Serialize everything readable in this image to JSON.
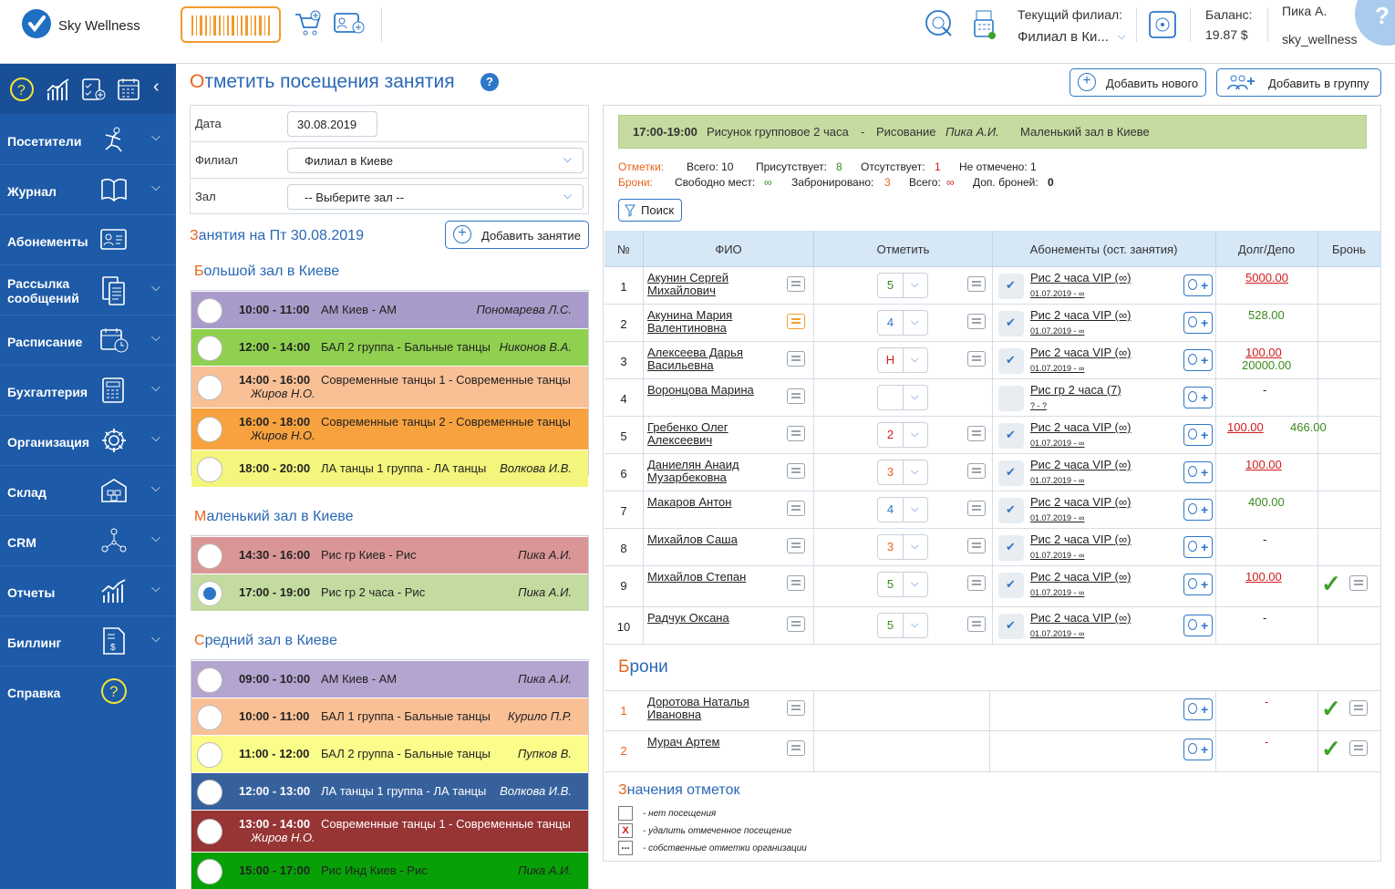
{
  "app": {
    "name": "Sky Wellness"
  },
  "header": {
    "branch_label": "Текущий филиал:",
    "branch_value": "Филиал в Ки...",
    "balance_label": "Баланс:",
    "balance_value": "19.87 $",
    "user_name": "Пика А.",
    "user_login": "sky_wellness",
    "help": "?"
  },
  "sidebar": {
    "items": [
      {
        "label": "Посетители"
      },
      {
        "label": "Журнал"
      },
      {
        "label": "Абонементы"
      },
      {
        "label": "Рассылка сообщений"
      },
      {
        "label": "Расписание"
      },
      {
        "label": "Бухгалтерия"
      },
      {
        "label": "Организация"
      },
      {
        "label": "Склад"
      },
      {
        "label": "CRM"
      },
      {
        "label": "Отчеты"
      },
      {
        "label": "Биллинг"
      },
      {
        "label": "Справка"
      }
    ]
  },
  "page": {
    "title": "Отметить посещения занятия",
    "add_new": "Добавить нового",
    "add_to_group": "Добавить в группу",
    "help": "?"
  },
  "filters": {
    "date_label": "Дата",
    "date_value": "30.08.2019",
    "branch_label": "Филиал",
    "branch_value": "Филиал в Киеве",
    "hall_label": "Зал",
    "hall_value": "-- Выберите зал --"
  },
  "schedule": {
    "title": "Занятия на Пт 30.08.2019",
    "add_lesson": "Добавить занятие",
    "halls": [
      {
        "name": "Большой зал в Киеве",
        "classes": [
          {
            "time": "10:00 - 11:00",
            "name": "АМ Киев - АМ",
            "teacher": "Пономарева Л.С.",
            "color": "#a99bc9"
          },
          {
            "time": "12:00 - 14:00",
            "name": "БАЛ 2 группа - Бальные танцы",
            "teacher": "Никонов В.А.",
            "color": "#8fd14f"
          },
          {
            "time": "14:00 - 16:00",
            "name": "Современные танцы 1 - Современные танцы",
            "teacher": "Жиров Н.О.",
            "color": "#f9c096"
          },
          {
            "time": "16:00 - 18:00",
            "name": "Современные танцы 2 - Современные танцы",
            "teacher": "Жиров Н.О.",
            "color": "#f8a23f"
          },
          {
            "time": "18:00 - 20:00",
            "name": "ЛА танцы 1 группа - ЛА танцы",
            "teacher": "Волкова И.В.",
            "color": "#f4f57c"
          }
        ]
      },
      {
        "name": "Маленький зал в Киеве",
        "classes": [
          {
            "time": "14:30 - 16:00",
            "name": "Рис гр Киев - Рис",
            "teacher": "Пика А.И.",
            "color": "#da9696"
          },
          {
            "time": "17:00 - 19:00",
            "name": "Рис гр 2 часа - Рис",
            "teacher": "Пика А.И.",
            "color": "#c4dba0"
          }
        ]
      },
      {
        "name": "Средний зал в Киеве",
        "classes": [
          {
            "time": "09:00 - 10:00",
            "name": "АМ Киев - АМ",
            "teacher": "Пика А.И.",
            "color": "#b3a4d0"
          },
          {
            "time": "10:00 - 11:00",
            "name": "БАЛ 1 группа - Бальные танцы",
            "teacher": "Курило П.Р.",
            "color": "#f9c096"
          },
          {
            "time": "11:00 - 12:00",
            "name": "БАЛ 2 группа - Бальные танцы",
            "teacher": "Пупков В.",
            "color": "#fbfd8a"
          },
          {
            "time": "12:00 - 13:00",
            "name": "ЛА танцы 1 группа - ЛА танцы",
            "teacher": "Волкова И.В.",
            "color": "#36619d"
          },
          {
            "time": "13:00 - 14:00",
            "name": "Современные танцы 1 - Современные танцы",
            "teacher": "Жиров Н.О.",
            "color": "#973434"
          },
          {
            "time": "15:00 - 17:00",
            "name": "Рис Инд Киев - Рис",
            "teacher": "Пика А.И.",
            "color": "#07a007"
          }
        ]
      }
    ]
  },
  "lesson": {
    "time": "17:00-19:00",
    "name": "Рисунок групповое 2 часа",
    "dash": "-",
    "subject": "Рисование",
    "teacher": "Пика А.И.",
    "hall": "Маленький зал в Киеве"
  },
  "stats": {
    "marks_label": "Отметки:",
    "total": "Всего: 10",
    "present_label": "Присутствует:",
    "present": "8",
    "absent_label": "Отсутствует:",
    "absent": "1",
    "unmarked": "Не отмечено: 1",
    "booking_label": "Брони:",
    "free_label": "Свободно мест:",
    "free": "∞",
    "booked_label": "Забронировано:",
    "booked": "3",
    "total2_label": "Всего:",
    "total2": "∞",
    "extra_label": "Доп. броней:",
    "extra": "0"
  },
  "search_btn": "Поиск",
  "table": {
    "headers": [
      "№",
      "ФИО",
      "Отметить",
      "Абонементы (ост. занятия)",
      "Долг/Депо",
      "Бронь"
    ],
    "rows": [
      {
        "n": "1",
        "name1": "Акунин Сергей",
        "name2": "Михайлович",
        "mark": "5",
        "sub": "Рис 2 часа VIP (∞)",
        "subdate": "01.07.2019 - ∞",
        "debt_red": "5000.00",
        "debt_green": ""
      },
      {
        "n": "2",
        "name1": "Акунина Мария",
        "name2": "Валентиновна",
        "mark": "4",
        "sub": "Рис 2 часа VIP (∞)",
        "subdate": "01.07.2019 - ∞",
        "debt_red": "",
        "debt_green": "528.00"
      },
      {
        "n": "3",
        "name1": "Алексеева Дарья",
        "name2": "Васильевна",
        "mark": "Н",
        "sub": "Рис 2 часа VIP (∞)",
        "subdate": "01.07.2019 - ∞",
        "debt_red": "100.00",
        "debt_green": "20000.00"
      },
      {
        "n": "4",
        "name1": "Воронцова Марина",
        "name2": "",
        "mark": "",
        "sub": "Рис гр 2 часа (7)",
        "subdate": "? - ?",
        "debt_red": "",
        "debt_green": "-"
      },
      {
        "n": "5",
        "name1": "Гребенко Олег",
        "name2": "Алексеевич",
        "mark": "2",
        "sub": "Рис 2 часа VIP (∞)",
        "subdate": "01.07.2019 - ∞",
        "debt_red": "100.00",
        "debt_green": "466.00"
      },
      {
        "n": "6",
        "name1": "Даниелян Анаид",
        "name2": "Музарбековна",
        "mark": "3",
        "sub": "Рис 2 часа VIP (∞)",
        "subdate": "01.07.2019 - ∞",
        "debt_red": "100.00",
        "debt_green": ""
      },
      {
        "n": "7",
        "name1": "Макаров Антон",
        "name2": "",
        "mark": "4",
        "sub": "Рис 2 часа VIP (∞)",
        "subdate": "01.07.2019 - ∞",
        "debt_red": "",
        "debt_green": "400.00"
      },
      {
        "n": "8",
        "name1": "Михайлов Саша",
        "name2": "",
        "mark": "3",
        "sub": "Рис 2 часа VIP (∞)",
        "subdate": "01.07.2019 - ∞",
        "debt_red": "",
        "debt_green": "-"
      },
      {
        "n": "9",
        "name1": "Михайлов Степан",
        "name2": "",
        "mark": "5",
        "sub": "Рис 2 часа VIP (∞)",
        "subdate": "01.07.2019 - ∞",
        "debt_red": "100.00",
        "debt_green": ""
      },
      {
        "n": "10",
        "name1": "Радчук Оксана",
        "name2": "",
        "mark": "5",
        "sub": "Рис 2 часа VIP (∞)",
        "subdate": "01.07.2019 - ∞",
        "debt_red": "",
        "debt_green": "-"
      }
    ]
  },
  "bookings": {
    "title": "Брони",
    "rows": [
      {
        "n": "1",
        "name1": "Доротова Наталья",
        "name2": "Ивановна",
        "debt": "-"
      },
      {
        "n": "2",
        "name1": "Мурач Артем",
        "name2": "",
        "debt": "-"
      }
    ]
  },
  "legend": {
    "title": "Значения отметок",
    "items": [
      {
        "symbol": "",
        "text": "- нет посещения"
      },
      {
        "symbol": "X",
        "text": "- удалить отмеченное посещение"
      },
      {
        "symbol": "...",
        "text": "- собственные отметки организации"
      }
    ]
  }
}
